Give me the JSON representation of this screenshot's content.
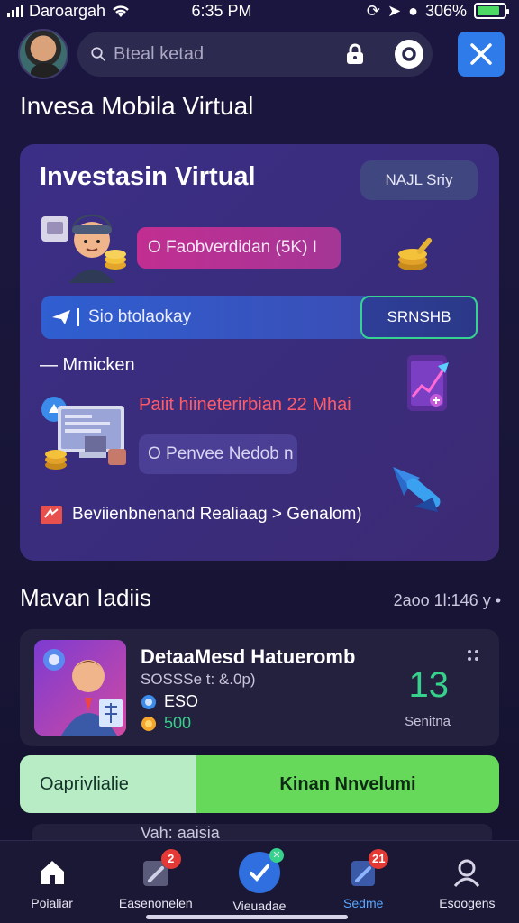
{
  "status_bar": {
    "carrier": "Daroargah",
    "time": "6:35 PM",
    "battery": "306%",
    "battery_level": 0.85
  },
  "header": {
    "search_placeholder": "Bteal ketad",
    "avatar_alt": "user-avatar"
  },
  "page": {
    "title": "Invesa Mobila Virtual"
  },
  "card": {
    "title": "Investasin Virtual",
    "tag": "NAJL Sriy",
    "pill_magenta": "O  Faobverdidan (5K) I",
    "blue_bar": "Sio btolaokay",
    "blue_bar_button": "SRNSHB",
    "sub_heading": "— Mmicken",
    "red_text": "Paiit hiineterirbian 22 Mhai",
    "pill_dark": "O  Penvee Nedob n",
    "footer_line": "Beviienbnenand Realiaag > Genalom)"
  },
  "section": {
    "title": "Mavan Iadiis",
    "meta": "2aoo  1l:146 y •"
  },
  "item": {
    "title": "DetaaMesd Hatueromb",
    "subtitle": "SOSSSe t: &.0p)",
    "row1": "ESO",
    "row2": "500",
    "count": "13",
    "count_label": "Senitna"
  },
  "toggle": {
    "left": "Oaprivlialie",
    "right": "Kinan Nnvelumi"
  },
  "peek": {
    "text": "Vah: aaisia"
  },
  "nav": [
    {
      "label": "Poialiar",
      "badge": ""
    },
    {
      "label": "Easenonelen",
      "badge": "2"
    },
    {
      "label": "Vieuadae",
      "badge": ""
    },
    {
      "label": "Sedme",
      "badge": "21"
    },
    {
      "label": "Esoogens",
      "badge": ""
    }
  ],
  "colors": {
    "accent_blue": "#2f7bea",
    "accent_green": "#36d28c",
    "magenta": "#c22e92",
    "badge_red": "#e53935"
  }
}
